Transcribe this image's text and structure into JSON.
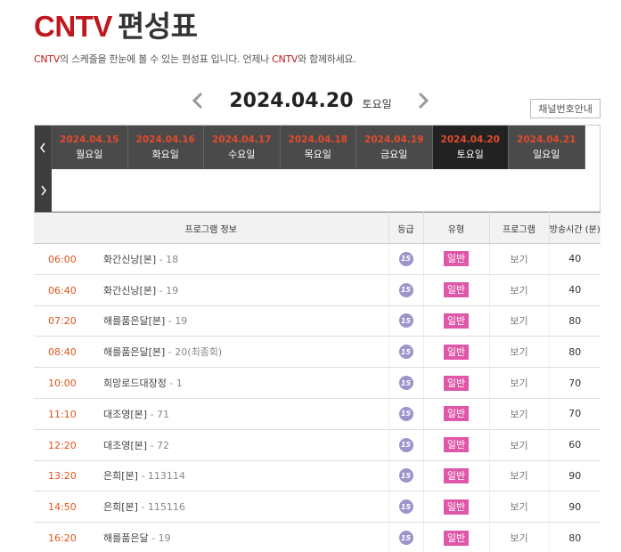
{
  "header": {
    "brand": "CNTV",
    "title_rest": "편성표",
    "subtitle_pre": "",
    "subtitle_brand1": "CNTV",
    "subtitle_mid": "의 스케줄을 한눈에 볼 수 있는 편성표 입니다. 언제나 ",
    "subtitle_brand2": "CNTV",
    "subtitle_post": "와 함께하세요."
  },
  "date_nav": {
    "current_date": "2024.04.20",
    "current_day": "토요일",
    "prev_icon": "chevron-left-icon",
    "next_icon": "chevron-right-icon"
  },
  "channel_button": "채널번호안내",
  "day_tabs": [
    {
      "date": "2024.04.15",
      "day": "월요일",
      "active": false
    },
    {
      "date": "2024.04.16",
      "day": "화요일",
      "active": false
    },
    {
      "date": "2024.04.17",
      "day": "수요일",
      "active": false
    },
    {
      "date": "2024.04.18",
      "day": "목요일",
      "active": false
    },
    {
      "date": "2024.04.19",
      "day": "금요일",
      "active": false
    },
    {
      "date": "2024.04.20",
      "day": "토요일",
      "active": true
    },
    {
      "date": "2024.04.21",
      "day": "일요일",
      "active": false
    }
  ],
  "table": {
    "headers": {
      "program": "프로그램 정보",
      "grade": "등급",
      "type": "유형",
      "program_col": "프로그램",
      "duration": "방송시간 (분)"
    },
    "rows": [
      {
        "time": "06:00",
        "name": "화간신낭[본]",
        "ep": " - 18",
        "grade": "15",
        "type": "일반",
        "view": "보기",
        "duration": "40"
      },
      {
        "time": "06:40",
        "name": "화간신낭[본]",
        "ep": " - 19",
        "grade": "15",
        "type": "일반",
        "view": "보기",
        "duration": "40"
      },
      {
        "time": "07:20",
        "name": "해를품은달[본]",
        "ep": " - 19",
        "grade": "15",
        "type": "일반",
        "view": "보기",
        "duration": "80"
      },
      {
        "time": "08:40",
        "name": "해를품은달[본]",
        "ep": " - 20(최종회)",
        "grade": "15",
        "type": "일반",
        "view": "보기",
        "duration": "80"
      },
      {
        "time": "10:00",
        "name": "희망로드대장정",
        "ep": " - 1",
        "grade": "15",
        "type": "일반",
        "view": "보기",
        "duration": "70"
      },
      {
        "time": "11:10",
        "name": "대조영[본]",
        "ep": " - 71",
        "grade": "15",
        "type": "일반",
        "view": "보기",
        "duration": "70"
      },
      {
        "time": "12:20",
        "name": "대조영[본]",
        "ep": " - 72",
        "grade": "15",
        "type": "일반",
        "view": "보기",
        "duration": "60"
      },
      {
        "time": "13:20",
        "name": "은희[본]",
        "ep": " - 113114",
        "grade": "15",
        "type": "일반",
        "view": "보기",
        "duration": "90"
      },
      {
        "time": "14:50",
        "name": "은희[본]",
        "ep": " - 115116",
        "grade": "15",
        "type": "일반",
        "view": "보기",
        "duration": "90"
      },
      {
        "time": "16:20",
        "name": "해를품은달",
        "ep": " - 19",
        "grade": "15",
        "type": "일반",
        "view": "보기",
        "duration": "80"
      }
    ]
  },
  "colors": {
    "brand_red": "#c0181f",
    "time_orange": "#e0541a",
    "tab_date": "#e44a2c",
    "badge_pink": "#e056a8",
    "grade_purple": "#9b95cc"
  }
}
